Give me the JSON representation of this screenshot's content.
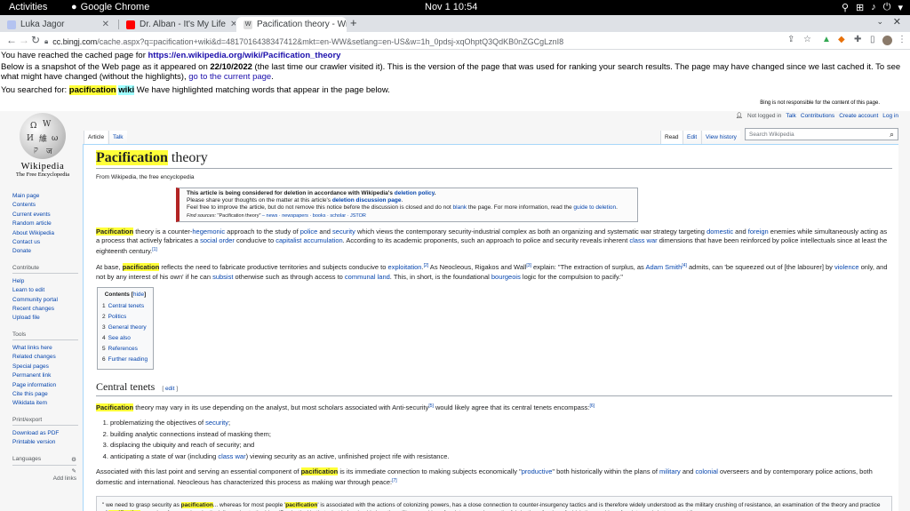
{
  "topbar": {
    "activities": "Activities",
    "app_name": "Google Chrome",
    "clock": "Nov 1  10:54"
  },
  "tabs": [
    {
      "label": "Luka Jagor",
      "favicon_color": "#b4c3f0"
    },
    {
      "label": "Dr. Alban - It's My Life",
      "favicon_color": "#ff0000"
    },
    {
      "label": "Pacification theory - Wiki",
      "favicon_color": "#dddddd"
    }
  ],
  "newtab": "+",
  "address": {
    "domain": "cc.bingj.com",
    "path": "/cache.aspx?q=pacification+wiki&d=4817016438347412&mkt=en-WW&setlang=en-US&w=1h_0pdsj-xqOhptQ3QdKB0nZGCgLznI8"
  },
  "cache": {
    "line1_prefix": "You have reached the cached page for ",
    "line1_url": "https://en.wikipedia.org/wiki/Pacification_theory",
    "line2_prefix": "Below is a snapshot of the Web page as it appeared on ",
    "line2_date": "22/10/2022",
    "line2_rest": " (the last time our crawler visited it). This is the version of the page that was used for ranking your search results. The page may have changed since we last cached it. To see what might have changed (without the highlights), ",
    "line2_link": "go to the current page",
    "line3_prefix": "You searched for: ",
    "term1": "pacification",
    "term2": "wiki",
    "line3_rest": " We have highlighted matching words that appear in the page below."
  },
  "bing_note": "Bing is not responsible for the content of this page.",
  "logo": {
    "wordmark": "Wikipedia",
    "tagline": "The Free Encyclopedia"
  },
  "personal": {
    "not_logged": "Not logged in",
    "talk": "Talk",
    "contrib": "Contributions",
    "create": "Create account",
    "login": "Log in"
  },
  "tabs_left": {
    "article": "Article",
    "talk": "Talk"
  },
  "tabs_right": {
    "read": "Read",
    "edit": "Edit",
    "history": "View history"
  },
  "search_placeholder": "Search Wikipedia",
  "sidebar": {
    "main": [
      "Main page",
      "Contents",
      "Current events",
      "Random article",
      "About Wikipedia",
      "Contact us",
      "Donate"
    ],
    "contribute_h": "Contribute",
    "contribute": [
      "Help",
      "Learn to edit",
      "Community portal",
      "Recent changes",
      "Upload file"
    ],
    "tools_h": "Tools",
    "tools": [
      "What links here",
      "Related changes",
      "Special pages",
      "Permanent link",
      "Page information",
      "Cite this page",
      "Wikidata item"
    ],
    "print_h": "Print/export",
    "print": [
      "Download as PDF",
      "Printable version"
    ],
    "languages": "Languages",
    "add_links": "Add links"
  },
  "article": {
    "title_hl": "Pacification",
    "title_rest": " theory",
    "from": "From Wikipedia, the free encyclopedia",
    "amb_l1": "This article is being considered for deletion in accordance with Wikipedia's ",
    "amb_l1_link": "deletion policy",
    "amb_l2": "Please share your thoughts on the matter at this article's ",
    "amb_l2_link": "deletion discussion page",
    "amb_l3a": "Feel free to improve the article, but do not remove this notice before the discussion is closed and do not ",
    "amb_l3_link1": "blank",
    "amb_l3b": " the page. For more information, read the ",
    "amb_l3_link2": "guide to deletion",
    "amb_src_label": "Find sources:",
    "amb_src_q": "\"Pacification theory\"",
    "amb_src_rest": " – news · newspapers · books · scholar · JSTOR",
    "toc_title": "Contents",
    "toc_hide": "hide",
    "toc": [
      {
        "n": "1",
        "label": "Central tenets"
      },
      {
        "n": "2",
        "label": "Politics"
      },
      {
        "n": "3",
        "label": "General theory"
      },
      {
        "n": "4",
        "label": "See also"
      },
      {
        "n": "5",
        "label": "References"
      },
      {
        "n": "6",
        "label": "Further reading"
      }
    ],
    "h2": "Central tenets",
    "edit": "edit",
    "list": [
      "problematizing the objectives of security;",
      "building analytic connections instead of masking them;",
      "displacing the ubiquity and reach of security; and",
      "anticipating a state of war (including class war) viewing security as an active, unfinished project rife with resistance."
    ]
  }
}
